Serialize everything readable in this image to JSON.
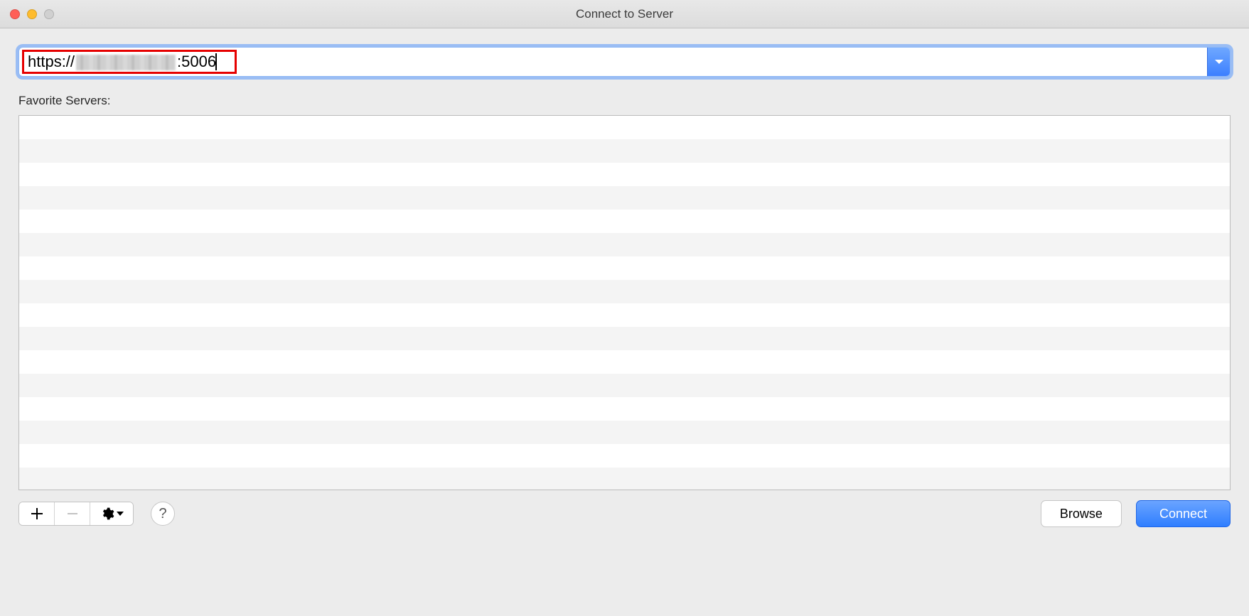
{
  "window": {
    "title": "Connect to Server"
  },
  "address": {
    "protocol_prefix": "https://",
    "port_suffix": ":5006",
    "value": ""
  },
  "favorites": {
    "label": "Favorite Servers:",
    "rows": 16
  },
  "toolbar": {
    "add_button_title": "Add",
    "remove_button_title": "Remove",
    "action_button_title": "Action",
    "help_button_title": "Help"
  },
  "buttons": {
    "browse": "Browse",
    "connect": "Connect"
  }
}
